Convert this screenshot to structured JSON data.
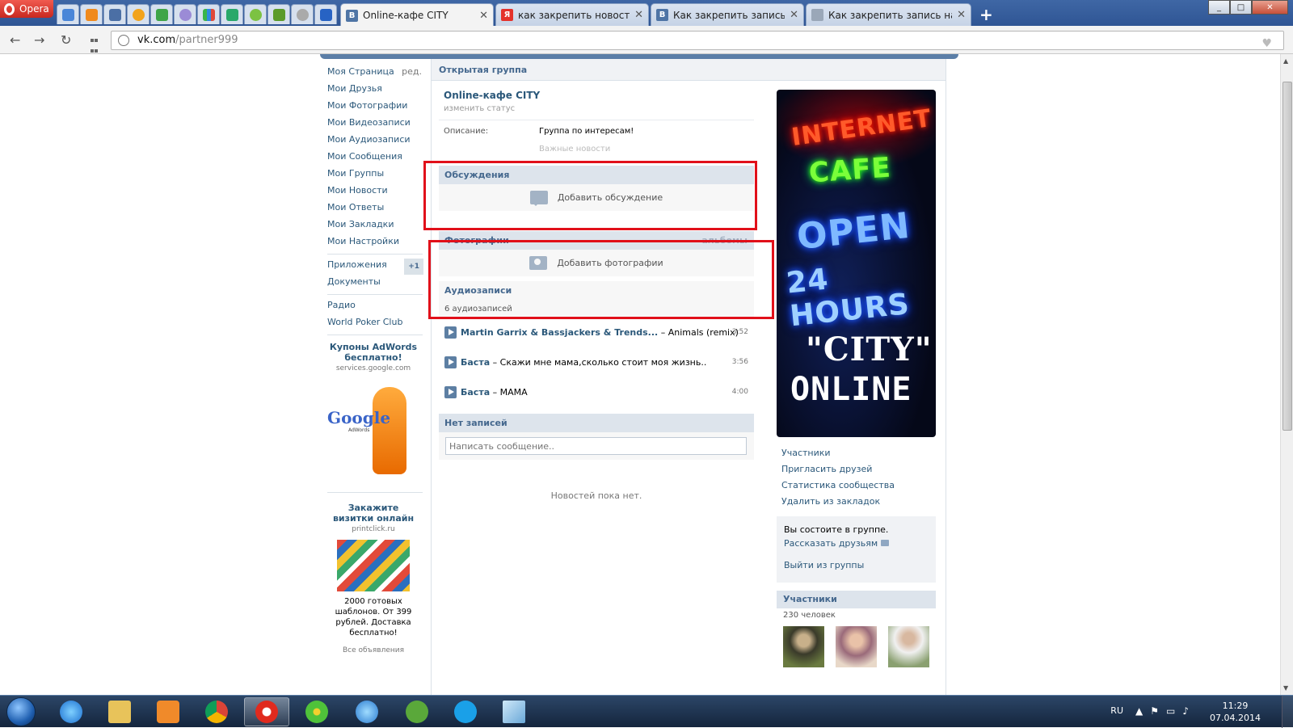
{
  "browser": {
    "menu_label": "Opera",
    "tabs": [
      {
        "label": "Online-кафе CITY",
        "fav": "B",
        "fav_color": "#4e74a5"
      },
      {
        "label": "как закрепить новость в г",
        "fav": "Я",
        "fav_color": "#e4322b"
      },
      {
        "label": "Как закрепить запись на с",
        "fav": "B",
        "fav_color": "#4e74a5"
      },
      {
        "label": "Как закрепить запись над",
        "fav": "",
        "fav_color": "#9aa7b8"
      }
    ],
    "new_tab": "+",
    "url_host": "vk.com",
    "url_path": "/partner999",
    "back": "←",
    "forward": "→",
    "reload": "↻",
    "minimize": "_",
    "maximize": "□",
    "close": "✕"
  },
  "left_menu": {
    "edit": "ред.",
    "items_top": [
      "Моя Страница",
      "Мои Друзья",
      "Мои Фотографии",
      "Мои Видеозаписи",
      "Мои Аудиозаписи",
      "Мои Сообщения",
      "Мои Группы",
      "Мои Новости",
      "Мои Ответы",
      "Мои Закладки",
      "Мои Настройки"
    ],
    "apps": "Приложения",
    "apps_badge": "+1",
    "docs": "Документы",
    "radio": "Радио",
    "poker": "World Poker Club",
    "ad1": {
      "title": "Купоны AdWords бесплатно!",
      "domain": "services.google.com",
      "logo": "Google",
      "logo_sub": "AdWords"
    },
    "ad2": {
      "title": "Закажите визитки онлайн",
      "domain": "printclick.ru",
      "text": "2000 готовых шаблонов. От 399 рублей. Доставка бесплатно!"
    },
    "all_ads": "Все объявления"
  },
  "group": {
    "type": "Открытая группа",
    "name": "Online-кафе CITY",
    "change_status": "изменить статус",
    "desc_label": "Описание:",
    "desc_value": "Группа по интересам!",
    "faded_line": "Важные новости",
    "discussions": {
      "title": "Обсуждения",
      "add": "Добавить обсуждение"
    },
    "photos": {
      "title": "Фотографии",
      "albums": "альбомы",
      "add": "Добавить фотографии"
    },
    "audio": {
      "title": "Аудиозаписи",
      "count": "6 аудиозаписей",
      "tracks": [
        {
          "artist": "Martin Garrix & Bassjackers & Trends...",
          "title": "– Animals (remix)",
          "duration": "3:52"
        },
        {
          "artist": "Баста",
          "title": "– Скажи мне мама,сколько стоит моя жизнь..",
          "duration": "3:56"
        },
        {
          "artist": "Баста",
          "title": "– MAMA",
          "duration": "4:00"
        }
      ]
    },
    "wall": {
      "title": "Нет записей",
      "placeholder": "Написать сообщение..",
      "empty": "Новостей пока нет."
    }
  },
  "cover": {
    "line1": "INTERNET",
    "line2": "CAFE",
    "line3": "OPEN",
    "line4": "24 HOURS",
    "line5": "\"CITY\"",
    "line6": "ONLINE"
  },
  "side": {
    "links": [
      "Участники",
      "Пригласить друзей",
      "Статистика сообщества",
      "Удалить из закладок"
    ],
    "member_status": "Вы состоите в группе.",
    "tell_friends": "Рассказать друзьям",
    "leave": "Выйти из группы",
    "members_title": "Участники",
    "members_count": "230 человек"
  },
  "taskbar": {
    "lang": "RU",
    "time": "11:29",
    "date": "07.04.2014"
  }
}
